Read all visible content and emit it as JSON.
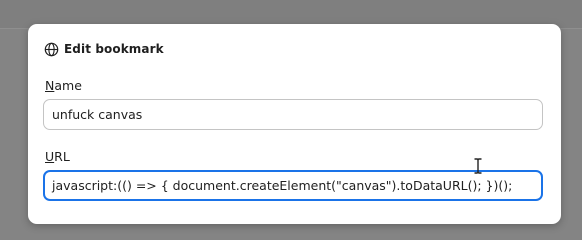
{
  "dialog": {
    "title": "Edit bookmark",
    "icon": "globe-icon"
  },
  "name_field": {
    "label_access_key": "N",
    "label_rest": "ame",
    "value": "unfuck canvas"
  },
  "url_field": {
    "label_access_key": "U",
    "label_rest": "RL",
    "value": "javascript:(() => { document.createElement(\"canvas\").toDataURL(); })();"
  },
  "colors": {
    "focus_border": "#1a73e8",
    "backdrop": "#848484"
  }
}
